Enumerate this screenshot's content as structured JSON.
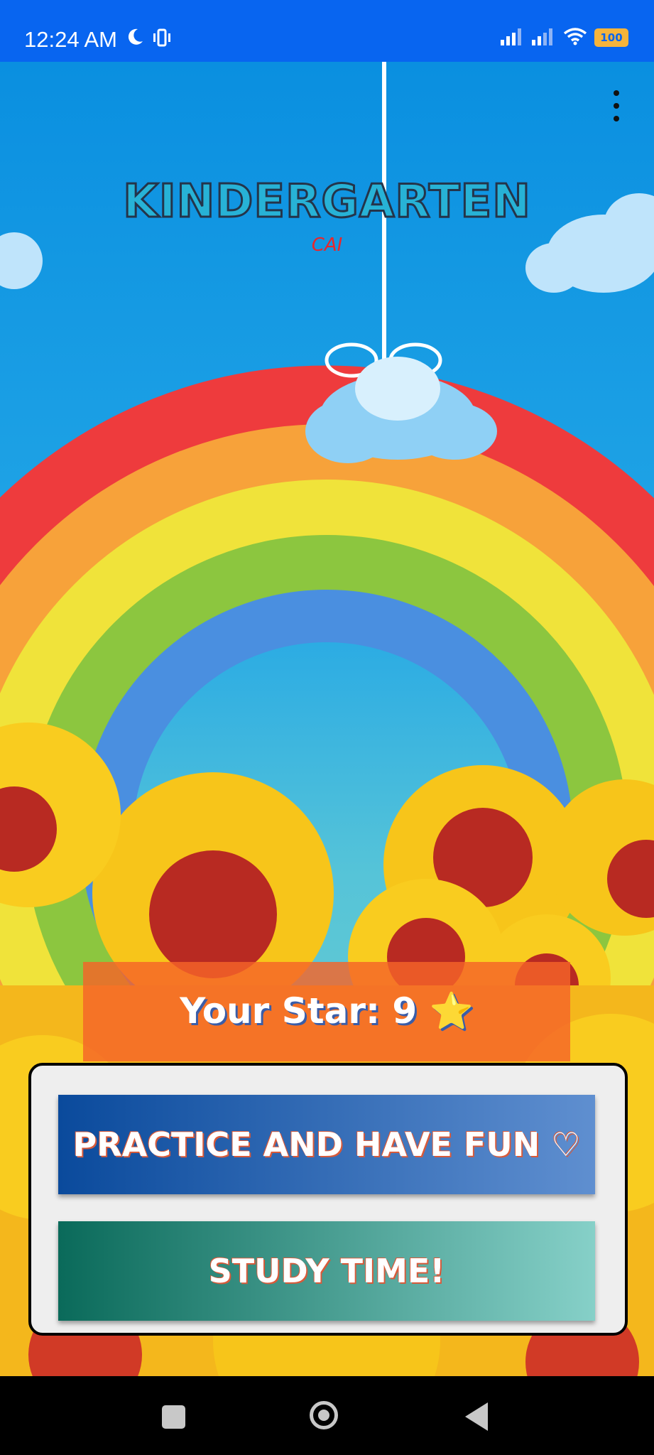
{
  "status_bar": {
    "time": "12:24 AM",
    "battery": "100",
    "icons": [
      "moon-icon",
      "vibrate-icon",
      "signal-icon",
      "signal-icon",
      "wifi-icon",
      "battery-icon"
    ]
  },
  "app": {
    "title": "KINDERGARTEN",
    "subtitle": "CAI",
    "menu_icon": "more-vert-icon"
  },
  "stars": {
    "label": "Your Star: 9 ⭐"
  },
  "buttons": {
    "practice": "PRACTICE AND HAVE FUN ♡",
    "study": "STUDY TIME!"
  },
  "nav_bar": {
    "icons": [
      "recents-icon",
      "home-icon",
      "back-icon"
    ]
  },
  "colors": {
    "status_bar": "#0865f0",
    "star_box": "#f56428",
    "practice_button": "#0a4a9c",
    "study_button": "#0a6a5a"
  }
}
